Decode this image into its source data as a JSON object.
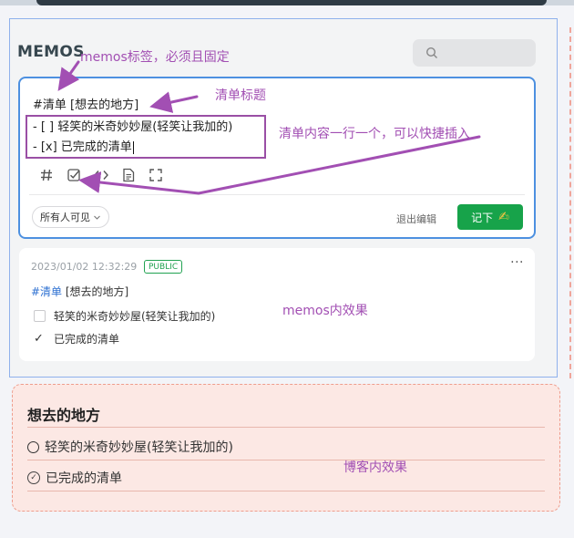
{
  "app": {
    "brand": "MEMOS"
  },
  "search": {
    "icon": "search-icon"
  },
  "editor": {
    "line1": "#清单 [想去的地方]",
    "line2": "- [ ] 轻笑的米奇妙妙屋(轻笑让我加的)",
    "line3": "- [x] 已完成的清单",
    "toolbar": {
      "tag_icon": "hash-icon",
      "checkbox_icon": "checkbox-icon",
      "code_icon": "code-icon",
      "file_icon": "document-icon",
      "fullscreen_icon": "fullscreen-icon"
    },
    "visibility": "所有人可见",
    "exit_label": "退出编辑",
    "save_label": "记下",
    "save_emoji": "✍"
  },
  "memo": {
    "time": "2023/01/02 12:32:29",
    "badge": "PUBLIC",
    "more": "···",
    "tag": "#清单",
    "title_rest": " [想去的地方]",
    "items": [
      {
        "label": "轻笑的米奇妙妙屋(轻笑让我加的)",
        "done": false
      },
      {
        "label": "已完成的清单",
        "done": true
      }
    ]
  },
  "blog": {
    "title": "想去的地方",
    "items": [
      {
        "label": "轻笑的米奇妙妙屋(轻笑让我加的)",
        "done": false
      },
      {
        "label": "已完成的清单",
        "done": true
      }
    ]
  },
  "annotations": {
    "tag_note": "memos标签，必须且固定",
    "title_note": "清单标题",
    "content_note": "清单内容一行一个，可以快捷插入",
    "memos_effect": "memos内效果",
    "blog_effect": "博客内效果",
    "color": "#a24fb3"
  }
}
